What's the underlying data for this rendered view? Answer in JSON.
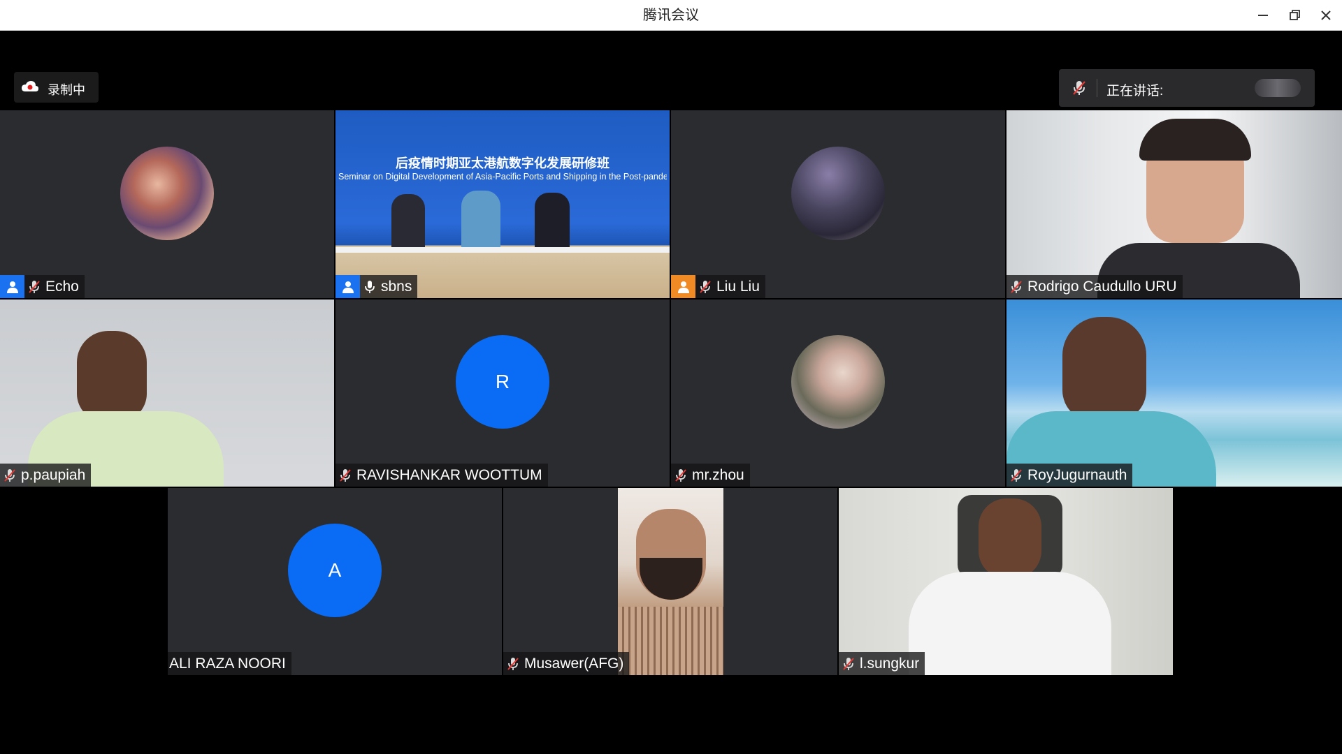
{
  "window": {
    "title": "腾讯会议"
  },
  "recording": {
    "label": "录制中",
    "icon": "cloud-record-icon"
  },
  "speaking": {
    "label": "正在讲话:",
    "icon": "mic-muted-icon"
  },
  "seminar_banner": {
    "title_cn": "后疫情时期亚太港航数字化发展研修班",
    "title_en": "Seminar on Digital Development of Asia-Pacific Ports and Shipping in the Post-pandemic Period"
  },
  "participants": [
    {
      "name": "Echo",
      "host": "blue",
      "mic": "muted"
    },
    {
      "name": "sbns",
      "host": "blue",
      "mic": "on"
    },
    {
      "name": "Liu Liu",
      "host": "orange",
      "mic": "muted"
    },
    {
      "name": "Rodrigo Caudullo URU",
      "mic": "muted"
    },
    {
      "name": "p.paupiah",
      "mic": "muted"
    },
    {
      "name": "RAVISHANKAR WOOTTUM",
      "mic": "muted",
      "avatar_letter": "R"
    },
    {
      "name": "mr.zhou",
      "mic": "muted"
    },
    {
      "name": "RoyJugurnauth",
      "mic": "muted"
    },
    {
      "name": "ALI RAZA NOORI",
      "avatar_letter": "A"
    },
    {
      "name": "Musawer(AFG)",
      "mic": "muted"
    },
    {
      "name": "l.sungkur",
      "mic": "muted"
    }
  ],
  "colors": {
    "avatar_blue": "#0a6cf5",
    "host_blue": "#1a72f0",
    "host_orange": "#f08a24",
    "tile_bg": "#2b2c2f"
  }
}
